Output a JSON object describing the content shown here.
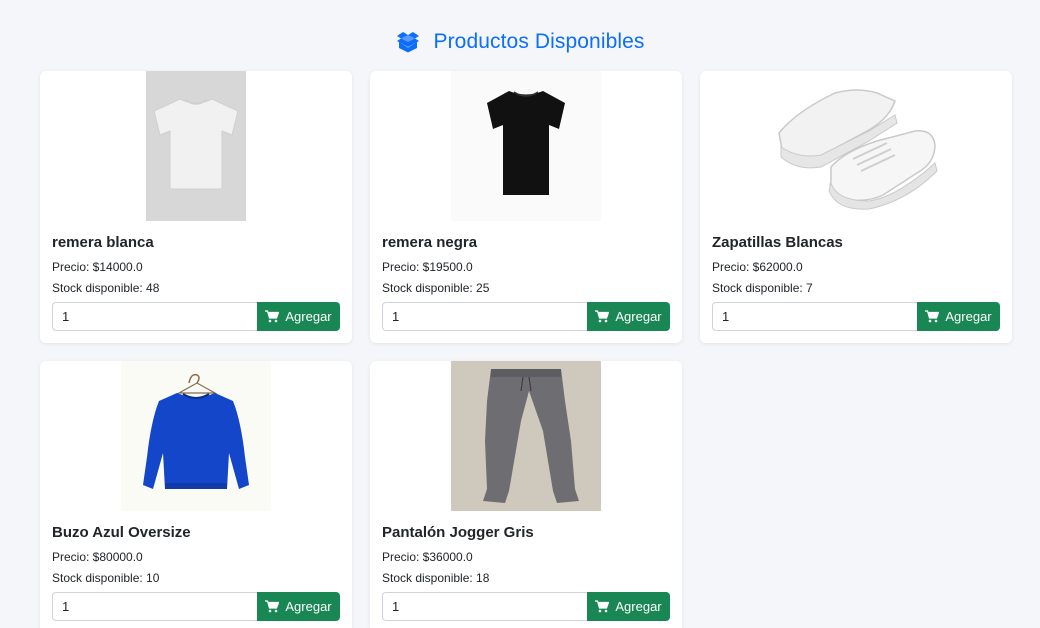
{
  "page": {
    "title": "Productos Disponibles",
    "title_icon": "box-open-icon",
    "accent_color": "#0d6efd",
    "button_color": "#198754"
  },
  "products": [
    {
      "name": "remera blanca",
      "price": "Precio: $14000.0",
      "stock": "Stock disponible: 48",
      "quantity": "1",
      "button_label": "Agregar",
      "image": "white-tshirt-image"
    },
    {
      "name": "remera negra",
      "price": "Precio: $19500.0",
      "stock": "Stock disponible: 25",
      "quantity": "1",
      "button_label": "Agregar",
      "image": "black-tshirt-image"
    },
    {
      "name": "Zapatillas Blancas",
      "price": "Precio: $62000.0",
      "stock": "Stock disponible: 7",
      "quantity": "1",
      "button_label": "Agregar",
      "image": "white-sneakers-image"
    },
    {
      "name": "Buzo Azul Oversize",
      "price": "Precio: $80000.0",
      "stock": "Stock disponible: 10",
      "quantity": "1",
      "button_label": "Agregar",
      "image": "blue-sweatshirt-image"
    },
    {
      "name": "Pantalón Jogger Gris",
      "price": "Precio: $36000.0",
      "stock": "Stock disponible: 18",
      "quantity": "1",
      "button_label": "Agregar",
      "image": "grey-jogger-image"
    }
  ]
}
